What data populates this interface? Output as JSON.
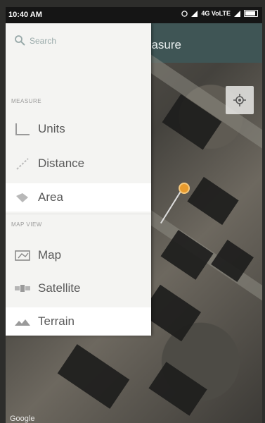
{
  "status_bar": {
    "time": "10:40 AM",
    "network": "4G VoLTE"
  },
  "toolbar": {
    "title_fragment": "easure"
  },
  "drawer": {
    "search": {
      "label": "Search"
    },
    "sections": [
      {
        "header": "MEASURE"
      },
      {
        "header": "MAP VIEW"
      }
    ],
    "items": [
      {
        "label": "Units",
        "icon": "ruler-icon",
        "selected": false
      },
      {
        "label": "Distance",
        "icon": "distance-icon",
        "selected": false
      },
      {
        "label": "Area",
        "icon": "area-icon",
        "selected": true
      },
      {
        "label": "Map",
        "icon": "map-icon",
        "selected": false
      },
      {
        "label": "Satellite",
        "icon": "satellite-icon",
        "selected": false
      },
      {
        "label": "Terrain",
        "icon": "terrain-icon",
        "selected": true
      }
    ]
  },
  "map": {
    "attribution": "Google"
  },
  "colors": {
    "toolbar": "#3f5555",
    "drawer": "#f4f4f2",
    "pin": "#e89b2e"
  }
}
